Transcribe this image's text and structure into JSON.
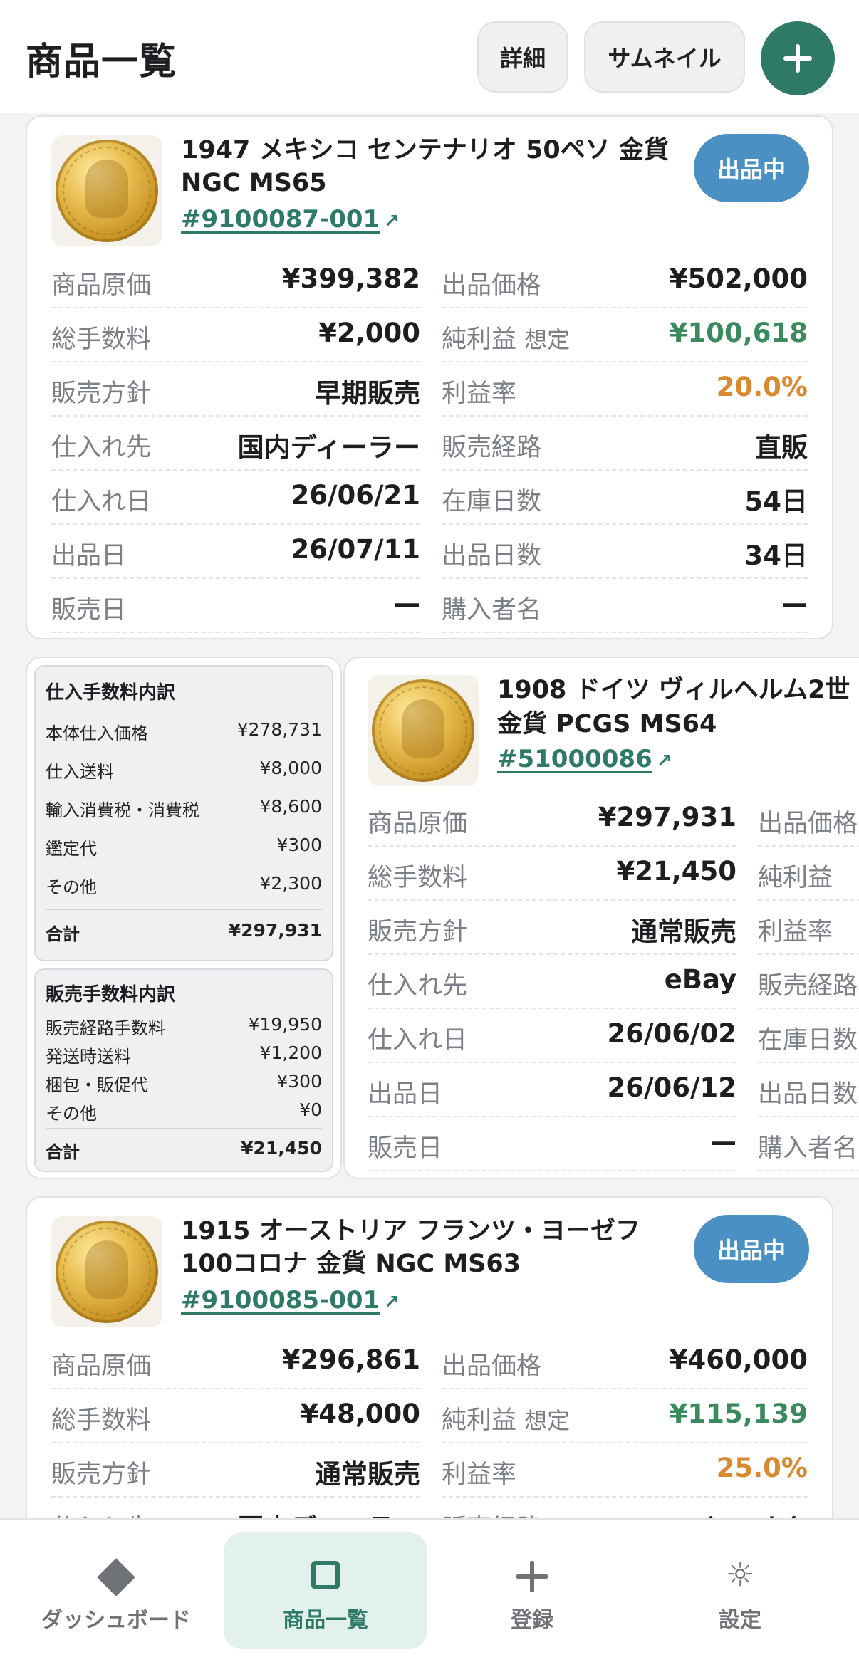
{
  "header": {
    "title": "商品一覧",
    "detail_label": "詳細",
    "thumbnail_label": "サムネイル",
    "add_icon": "plus-icon"
  },
  "items": [
    {
      "title_line1": "1947 メキシコ センテナリオ 50ペソ 金貨",
      "title_line2": "NGC MS65",
      "sku": "#9100087-001",
      "status": "出品中",
      "fields": [
        {
          "label": "商品原価",
          "value": "¥399,382"
        },
        {
          "label": "出品価格",
          "value": "¥502,000"
        },
        {
          "label": "総手数料",
          "value": "¥2,000"
        },
        {
          "label": "純利益",
          "label_sub": "想定",
          "value": "¥100,618"
        },
        {
          "label": "販売方針",
          "value": "早期販売"
        },
        {
          "label": "利益率",
          "value": "20.0%"
        },
        {
          "label": "仕入れ先",
          "value": "国内ディーラー"
        },
        {
          "label": "販売経路",
          "value": "直販"
        },
        {
          "label": "仕入れ日",
          "value": "26/06/21"
        },
        {
          "label": "在庫日数",
          "value": "54日"
        },
        {
          "label": "出品日",
          "value": "26/07/11"
        },
        {
          "label": "出品日数",
          "value": "34日"
        },
        {
          "label": "販売日",
          "value": "—"
        },
        {
          "label": "購入者名",
          "value": "—"
        }
      ]
    },
    {
      "title_line1": "1908 ドイツ ヴィルヘルム2世",
      "title_line2": "金貨 PCGS MS64",
      "sku": "#51000086",
      "fields": [
        {
          "label": "商品原価",
          "value": "¥297,931"
        },
        {
          "label": "出品価格"
        },
        {
          "label": "総手数料",
          "value": "¥21,450"
        },
        {
          "label": "純利益"
        },
        {
          "label": "販売方針",
          "value": "通常販売"
        },
        {
          "label": "利益率"
        },
        {
          "label": "仕入れ先",
          "value": "eBay"
        },
        {
          "label": "販売経路"
        },
        {
          "label": "仕入れ日",
          "value": "26/06/02"
        },
        {
          "label": "在庫日数"
        },
        {
          "label": "出品日",
          "value": "26/06/12"
        },
        {
          "label": "出品日数"
        },
        {
          "label": "販売日",
          "value": "—"
        },
        {
          "label": "購入者名"
        }
      ],
      "purchase_breakdown": {
        "title": "仕入手数料内訳",
        "rows": [
          {
            "label": "本体仕入価格",
            "value": "¥278,731"
          },
          {
            "label": "仕入送料",
            "value": "¥8,000"
          },
          {
            "label": "輸入消費税・消費税",
            "value": "¥8,600"
          },
          {
            "label": "鑑定代",
            "value": "¥300"
          },
          {
            "label": "その他",
            "value": "¥2,300"
          }
        ],
        "total_label": "合計",
        "total_value": "¥297,931"
      },
      "sales_breakdown": {
        "title": "販売手数料内訳",
        "rows": [
          {
            "label": "販売経路手数料",
            "value": "¥19,950"
          },
          {
            "label": "発送時送料",
            "value": "¥1,200"
          },
          {
            "label": "梱包・販促代",
            "value": "¥300"
          },
          {
            "label": "その他",
            "value": "¥0"
          }
        ],
        "total_label": "合計",
        "total_value": "¥21,450"
      }
    },
    {
      "title_line1": "1915 オーストリア フランツ・ヨーゼフ",
      "title_line2": "100コロナ 金貨 NGC MS63",
      "sku": "#9100085-001",
      "status": "出品中",
      "fields": [
        {
          "label": "商品原価",
          "value": "¥296,861"
        },
        {
          "label": "出品価格",
          "value": "¥460,000"
        },
        {
          "label": "総手数料",
          "value": "¥48,000"
        },
        {
          "label": "純利益",
          "label_sub": "想定",
          "value": "¥115,139"
        },
        {
          "label": "販売方針",
          "value": "通常販売"
        },
        {
          "label": "利益率",
          "value": "25.0%"
        },
        {
          "label": "仕入れ先",
          "value": "国内ディーラー"
        },
        {
          "label": "販売経路",
          "value": "ヤフオク"
        }
      ]
    }
  ],
  "colors": {
    "accent": "#2e7a67",
    "status_badge": "#4a90c2",
    "profit": "#3a8a5e",
    "margin": "#d98a30"
  },
  "bottom_nav": [
    {
      "label": "ダッシュボード",
      "icon": "diamond-icon"
    },
    {
      "label": "商品一覧",
      "icon": "square-icon",
      "active": true
    },
    {
      "label": "登録",
      "icon": "plus-icon"
    },
    {
      "label": "設定",
      "icon": "gear-icon"
    }
  ]
}
